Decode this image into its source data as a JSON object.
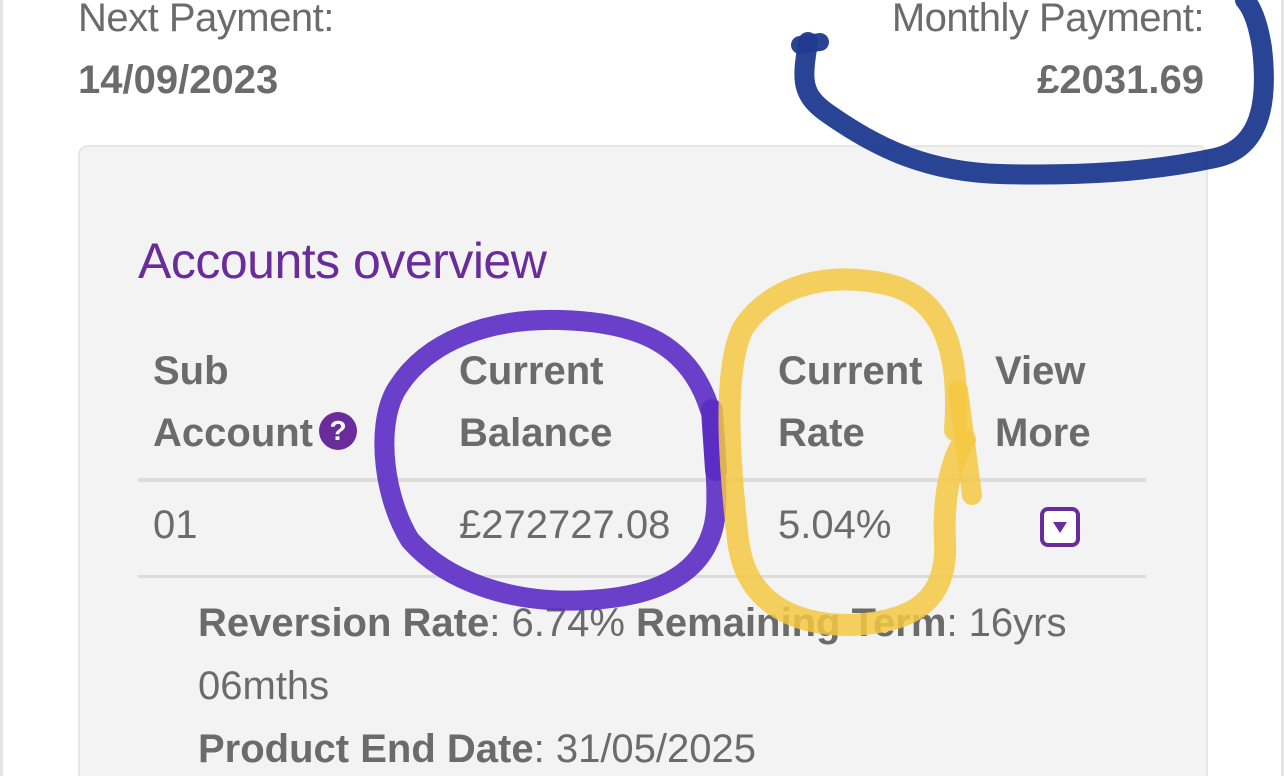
{
  "payments": {
    "next_label": "Next Payment:",
    "next_value": "14/09/2023",
    "monthly_label": "Monthly Payment:",
    "monthly_value": "£2031.69"
  },
  "accounts": {
    "title": "Accounts overview",
    "headers": {
      "sub_line1": "Sub",
      "sub_line2": "Account",
      "help_glyph": "?",
      "balance_line1": "Current",
      "balance_line2": "Balance",
      "rate_line1": "Current",
      "rate_line2": "Rate",
      "more_line1": "View",
      "more_line2": "More"
    },
    "rows": [
      {
        "sub_account": "01",
        "balance": "£272727.08",
        "rate": "5.04%",
        "details": {
          "reversion_label": "Reversion Rate",
          "reversion_value": ": 6.74% ",
          "term_label": "Remaining Term",
          "term_value": ": 16yrs 06mths",
          "end_label": "Product End Date",
          "end_value": ": 31/05/2025"
        }
      }
    ]
  },
  "icons": {
    "help": "question-circle-icon",
    "expand": "chevron-down-square-icon"
  },
  "colors": {
    "brand_purple": "#6a2c9a",
    "text_grey": "#6b6b6b",
    "panel_bg": "#f3f3f3",
    "annotation_blue": "#1f3a8f",
    "annotation_purple": "#5b2bc4",
    "annotation_yellow": "#f5c842"
  }
}
